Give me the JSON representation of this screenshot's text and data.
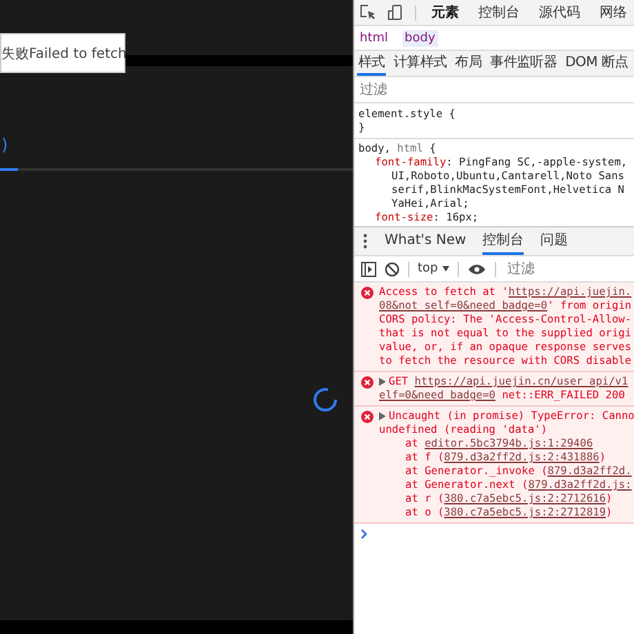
{
  "page": {
    "toast": "失败Failed to fetch",
    "cut_text": ")",
    "tab_indicator": {
      "level": 0.05
    },
    "loading": true
  },
  "devtools": {
    "tabs": [
      {
        "label": "元素",
        "selected": true
      },
      {
        "label": "控制台",
        "selected": false
      },
      {
        "label": "源代码",
        "selected": false
      },
      {
        "label": "网络",
        "selected": false
      }
    ],
    "breadcrumb": [
      {
        "label": "html",
        "selected": false
      },
      {
        "label": "body",
        "selected": true
      }
    ],
    "style_tabs": [
      {
        "label": "样式",
        "selected": true
      },
      {
        "label": "计算样式",
        "selected": false
      },
      {
        "label": "布局",
        "selected": false
      },
      {
        "label": "事件监听器",
        "selected": false
      },
      {
        "label": "DOM 断点",
        "selected": false
      }
    ],
    "style_filter": {
      "placeholder": "过滤"
    },
    "style_lines": [
      {
        "kind": "rule",
        "segments": [
          {
            "kind": "selector",
            "text": "element.style {"
          }
        ]
      },
      {
        "kind": "rule",
        "segments": [
          {
            "kind": "plain",
            "text": "}"
          }
        ]
      },
      {
        "kind": "rule",
        "segments": [
          {
            "kind": "selector",
            "text": "body, "
          },
          {
            "kind": "dim",
            "text": "html"
          },
          {
            "kind": "plain",
            "text": " {"
          }
        ]
      },
      {
        "kind": "declaration",
        "segments": [
          {
            "kind": "prop",
            "text": "font-family"
          },
          {
            "kind": "plain",
            "text": ": PingFang SC,-apple-system,"
          }
        ]
      },
      {
        "kind": "continuation",
        "segments": [
          {
            "kind": "plain",
            "text": "UI,Roboto,Ubuntu,Cantarell,Noto Sans"
          }
        ]
      },
      {
        "kind": "continuation",
        "segments": [
          {
            "kind": "plain",
            "text": "serif,BlinkMacSystemFont,Helvetica N"
          }
        ]
      },
      {
        "kind": "continuation",
        "segments": [
          {
            "kind": "plain",
            "text": "YaHei,Arial;"
          }
        ]
      },
      {
        "kind": "declaration",
        "segments": [
          {
            "kind": "prop",
            "text": "font-size"
          },
          {
            "kind": "plain",
            "text": ": 16px;"
          }
        ]
      }
    ]
  },
  "drawer": {
    "tabs": [
      {
        "label": "What's New",
        "selected": false
      },
      {
        "label": "控制台",
        "selected": true
      },
      {
        "label": "问题",
        "selected": false
      }
    ],
    "context": "top",
    "filter": {
      "placeholder": "过滤"
    },
    "messages": [
      {
        "expandable": false,
        "lines": [
          [
            {
              "kind": "text",
              "text": "Access to fetch at '"
            },
            {
              "kind": "link",
              "text": "https://api.juejin."
            }
          ],
          [
            {
              "kind": "link",
              "text": "08&not_self=0&need_badge=0"
            },
            {
              "kind": "text",
              "text": "' from origin"
            }
          ],
          [
            {
              "kind": "text",
              "text": "CORS policy: The 'Access-Control-Allow-"
            }
          ],
          [
            {
              "kind": "text",
              "text": "that is not equal to the supplied origi"
            }
          ],
          [
            {
              "kind": "text",
              "text": "value, or, if an opaque response serves"
            }
          ],
          [
            {
              "kind": "text",
              "text": "to fetch the resource with CORS disable"
            }
          ]
        ]
      },
      {
        "expandable": true,
        "lines": [
          [
            {
              "kind": "text",
              "text": "GET "
            },
            {
              "kind": "link",
              "text": "https://api.juejin.cn/user_api/v1"
            }
          ],
          [
            {
              "kind": "link",
              "text": "elf=0&need_badge=0"
            },
            {
              "kind": "text",
              "text": " net::ERR_FAILED 200"
            }
          ]
        ]
      },
      {
        "expandable": true,
        "lines": [
          [
            {
              "kind": "text",
              "text": "Uncaught (in promise) TypeError: Canno"
            }
          ],
          [
            {
              "kind": "text",
              "text": "undefined (reading 'data')"
            }
          ],
          [
            {
              "kind": "stack",
              "text": "at "
            },
            {
              "kind": "link",
              "text": "editor.5bc3794b.js:1:29406"
            }
          ],
          [
            {
              "kind": "stack",
              "text": "at f ("
            },
            {
              "kind": "link",
              "text": "879.d3a2ff2d.js:2:431886"
            },
            {
              "kind": "text",
              "text": ")"
            }
          ],
          [
            {
              "kind": "stack",
              "text": "at Generator._invoke ("
            },
            {
              "kind": "link",
              "text": "879.d3a2ff2d."
            }
          ],
          [
            {
              "kind": "stack",
              "text": "at Generator.next ("
            },
            {
              "kind": "link",
              "text": "879.d3a2ff2d.js:"
            }
          ],
          [
            {
              "kind": "stack",
              "text": "at r ("
            },
            {
              "kind": "link",
              "text": "380.c7a5ebc5.js:2:2712616"
            },
            {
              "kind": "text",
              "text": ")"
            }
          ],
          [
            {
              "kind": "stack",
              "text": "at o ("
            },
            {
              "kind": "link",
              "text": "380.c7a5ebc5.js:2:2712819"
            },
            {
              "kind": "text",
              "text": ")"
            }
          ]
        ]
      }
    ]
  }
}
